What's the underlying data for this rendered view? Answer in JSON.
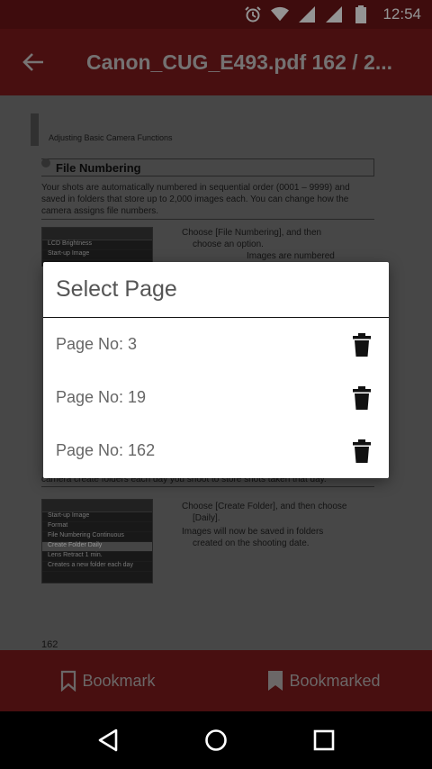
{
  "status_bar": {
    "time": "12:54",
    "icons": [
      "alarm-icon",
      "wifi-icon",
      "signal-icon",
      "signal-icon-2",
      "battery-icon"
    ]
  },
  "app_bar": {
    "title": "Canon_CUG_E493.pdf 162 / 2...",
    "back_icon": "arrow-left-icon"
  },
  "document": {
    "section_title": "Adjusting Basic Camera Functions",
    "heading": "File Numbering",
    "paragraph": "Your shots are automatically numbered in sequential order (0001 – 9999) and saved in folders that store up to 2,000 images each. You can change how the camera assigns file numbers.",
    "bullet_1a": "Choose [File Numbering], and then",
    "bullet_1b": "choose an option.",
    "bullet_1c": "Images are numbered",
    "lower_para": "camera create folders each day you shoot to store shots taken that day.",
    "bullet_2a": "Choose [Create Folder], and then choose",
    "bullet_2b": "[Daily].",
    "bullet_3a": "Images will now be saved in folders",
    "bullet_3b": "created on the shooting date.",
    "cam_menu_top": [
      "LCD Brightness",
      "Start-up Image"
    ],
    "cam_menu_bottom": [
      "Start-up Image",
      "Format",
      "File Numbering  Continuous",
      "Create Folder   Daily",
      "Lens Retract   1 min.",
      "Creates a new folder each day"
    ],
    "page_number": "162"
  },
  "dialog": {
    "title": "Select Page",
    "items": [
      {
        "label": "Page No: 3"
      },
      {
        "label": "Page No: 19"
      },
      {
        "label": "Page No: 162"
      }
    ],
    "delete_icon": "trash-icon"
  },
  "bottom_bar": {
    "bookmark_label": "Bookmark",
    "bookmarked_label": "Bookmarked"
  },
  "colors": {
    "status_bar": "#6b1517",
    "app_bar": "#7d1b1d",
    "dialog_bg": "#ffffff",
    "text_muted": "#666666"
  }
}
